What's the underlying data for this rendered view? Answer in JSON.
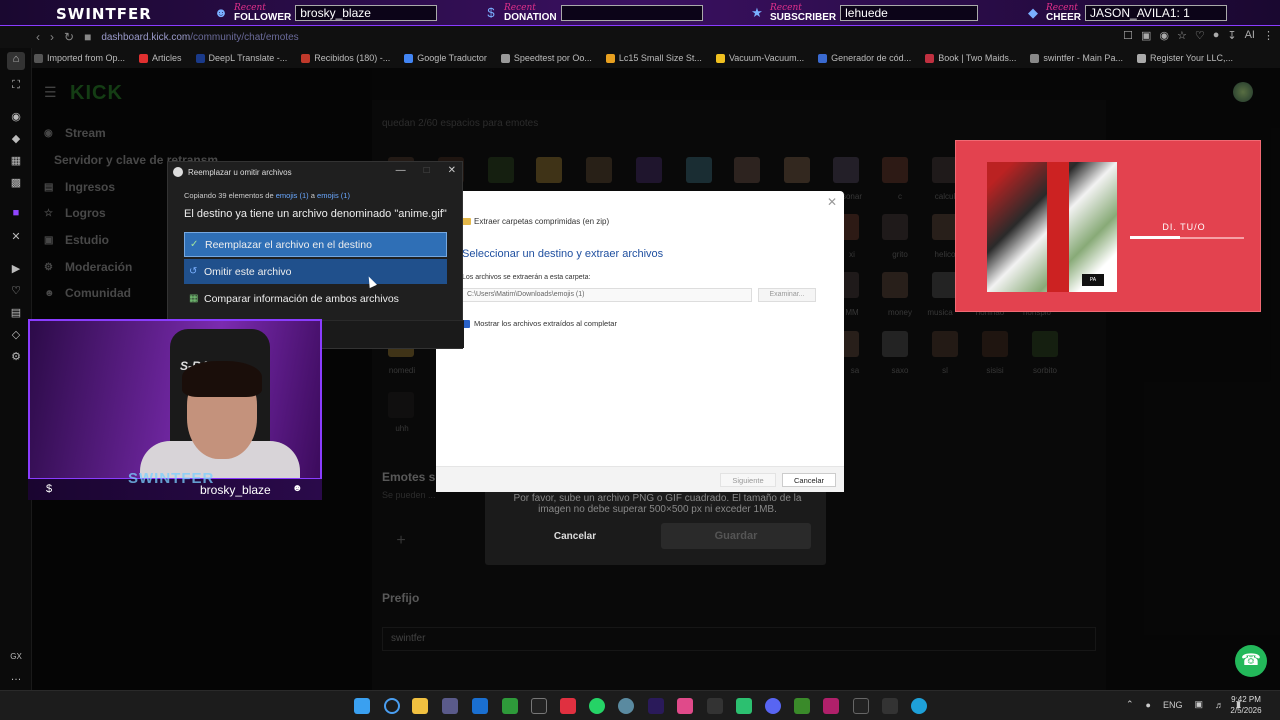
{
  "overlay": {
    "brand": "SWINTFER",
    "recent_word": "Recent",
    "follower": {
      "kind": "FOLLOWER",
      "value": "brosky_blaze"
    },
    "donation": {
      "kind": "DONATION",
      "value": ""
    },
    "subscriber": {
      "kind": "SUBSCRIBER",
      "value": "lehuede"
    },
    "cheer": {
      "kind": "CHEER",
      "value": "JASON_AVILA1: 1"
    }
  },
  "browser": {
    "url_host": "dashboard.kick.com",
    "url_path": "/community/chat/emotes",
    "bookmarks": [
      "Imported from Op...",
      "Articles",
      "DeepL Translate -...",
      "Recibidos (180) -...",
      "Google Traductor",
      "Speedtest por Oo...",
      "Lc15 Small Size St...",
      "Vacuum-Vacuum...",
      "Generador de cód...",
      "Book | Two Maids...",
      "swintfer - Main Pa...",
      "Register Your LLC,..."
    ]
  },
  "kick": {
    "logo": "KICK",
    "sidebar": [
      "Stream",
      "Servidor y clave de retransm",
      "Ingresos",
      "Logros",
      "Estudio",
      "Moderación",
      "Comunidad"
    ],
    "emote_slots_hint": "quedan 2/60 espacios para emotes",
    "emote_labels": [
      "c",
      "calcul",
      "grito",
      "helico",
      "money",
      "musica",
      "noninao",
      "nonspio",
      "nomedi",
      "sa",
      "saxo",
      "sl",
      "sisisi",
      "sorbito",
      "uhh",
      "sonar",
      "xi",
      "MM"
    ],
    "sub_section_title": "Emotes s",
    "sub_section_sub": "Se pueden ...",
    "prefix_title": "Prefijo",
    "prefix_value": "swintfer"
  },
  "upload_modal": {
    "text": "Por favor, sube un archivo PNG o GIF cuadrado. El tamaño de la imagen no debe superar 500×500 px ni exceder 1MB.",
    "cancel": "Cancelar",
    "save": "Guardar"
  },
  "extract_dialog": {
    "header": "Extraer carpetas comprimidas (en zip)",
    "title": "Seleccionar un destino y extraer archivos",
    "label": "Los archivos se extraerán a esta carpeta:",
    "path": "C:\\Users\\Matim\\Downloads\\emojis (1)",
    "browse": "Examinar...",
    "show_files": "Mostrar los archivos extraídos al completar",
    "next": "Siguiente",
    "cancel": "Cancelar"
  },
  "replace_dialog": {
    "title": "Reemplazar u omitir archivos",
    "copy_prefix": "Copiando 39 elementos de",
    "copy_src": "emojis (1)",
    "copy_mid": "a",
    "copy_dst": "emojis (1)",
    "dest_msg": "El destino ya tiene un archivo denominado \"anime.gif\"",
    "opt_replace": "Reemplazar el archivo en el destino",
    "opt_skip": "Omitir este archivo",
    "opt_compare": "Comparar información de ambos archivos"
  },
  "webcam": {
    "chair_brand": "S-RACER",
    "watermark": "SWINTFER",
    "username": "brosky_blaze"
  },
  "music": {
    "song": "DI. TU/O",
    "progress": 0.44
  },
  "taskbar": {
    "lang": "ENG",
    "time": "9:42 PM",
    "date": "2/5/2026"
  },
  "colors": {
    "overlay_accent": "#8a3cff",
    "music_bg": "#e3424f",
    "selected_option": "#2f6fb6",
    "help_button": "#23b85a"
  }
}
